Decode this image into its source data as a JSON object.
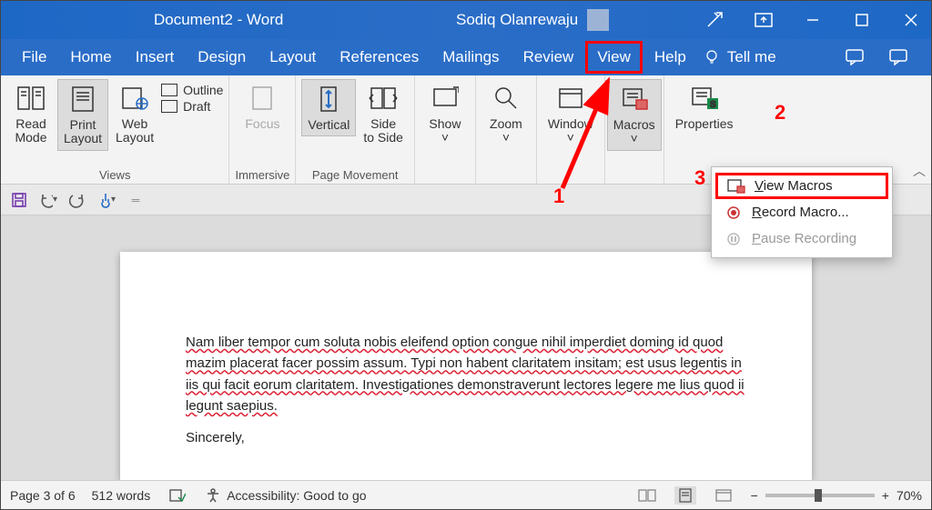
{
  "titlebar": {
    "doc_title": "Document2  -  Word",
    "user_name": "Sodiq Olanrewaju"
  },
  "menubar": {
    "items": [
      "File",
      "Home",
      "Insert",
      "Design",
      "Layout",
      "References",
      "Mailings",
      "Review",
      "View",
      "Help"
    ],
    "tell_me": "Tell me"
  },
  "ribbon": {
    "views": {
      "read_mode": "Read\nMode",
      "print_layout": "Print\nLayout",
      "web_layout": "Web\nLayout",
      "outline": "Outline",
      "draft": "Draft",
      "group": "Views"
    },
    "immersive": {
      "focus": "Focus",
      "group": "Immersive"
    },
    "page_movement": {
      "vertical": "Vertical",
      "side": "Side\nto Side",
      "group": "Page Movement"
    },
    "show": "Show",
    "zoom": "Zoom",
    "window": "Window",
    "macros": "Macros",
    "properties": "Properties"
  },
  "macros_menu": {
    "view": "View Macros",
    "record": "Record Macro...",
    "pause": "Pause Recording"
  },
  "callouts": {
    "one": "1",
    "two": "2",
    "three": "3"
  },
  "document": {
    "para": "Nam liber tempor cum soluta nobis eleifend option congue nihil imperdiet doming id quod mazim placerat facer possim assum. Typi non habent claritatem insitam; est usus legentis in iis qui facit eorum claritatem. Investigationes demonstraverunt lectores legere me lius quod ii legunt saepius.",
    "closing": "Sincerely,"
  },
  "statusbar": {
    "page": "Page 3 of 6",
    "words": "512 words",
    "accessibility": "Accessibility: Good to go",
    "zoom": "70%"
  }
}
